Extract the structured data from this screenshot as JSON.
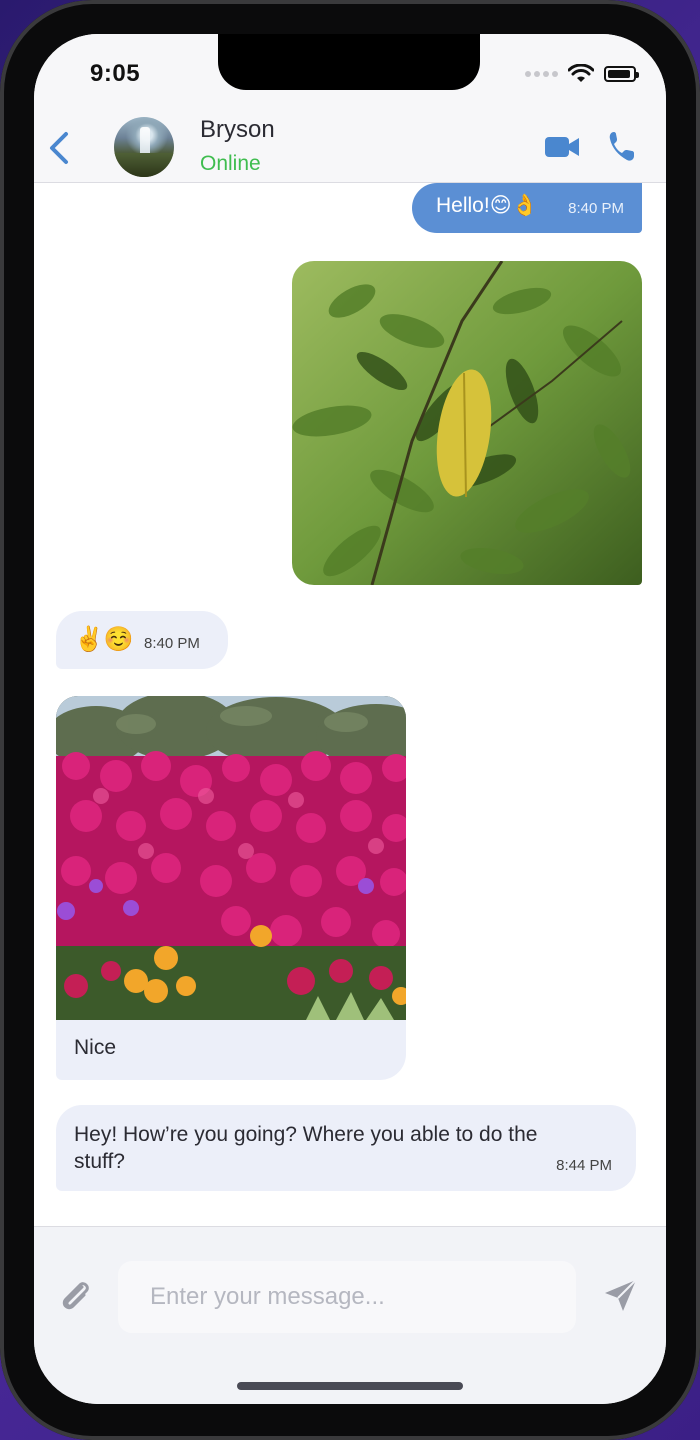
{
  "status_bar": {
    "time": "9:05"
  },
  "header": {
    "contact_name": "Bryson",
    "contact_status": "Online",
    "icons": {
      "back": "chevron-left-icon",
      "video": "video-camera-icon",
      "call": "phone-icon"
    },
    "accent_color": "#4a87cf",
    "online_color": "#3fbd4f"
  },
  "messages": [
    {
      "direction": "outgoing",
      "type": "text",
      "text": "Hello!😊👌",
      "time": "8:40 PM"
    },
    {
      "direction": "outgoing",
      "type": "image",
      "image_subject": "green leaves"
    },
    {
      "direction": "incoming",
      "type": "text",
      "text": "✌️☺️",
      "time": "8:40 PM"
    },
    {
      "direction": "incoming",
      "type": "image",
      "image_subject": "pink flowers",
      "caption": "Nice"
    },
    {
      "direction": "incoming",
      "type": "text",
      "text": "Hey! How’re you going? Where you able to do the stuff?",
      "time": "8:44 PM"
    }
  ],
  "composer": {
    "placeholder": "Enter your message...",
    "value": "",
    "icons": {
      "attach": "paperclip-icon",
      "send": "send-icon"
    }
  },
  "colors": {
    "outgoing_bubble": "#5b8fd4",
    "incoming_bubble": "#eceff9"
  }
}
